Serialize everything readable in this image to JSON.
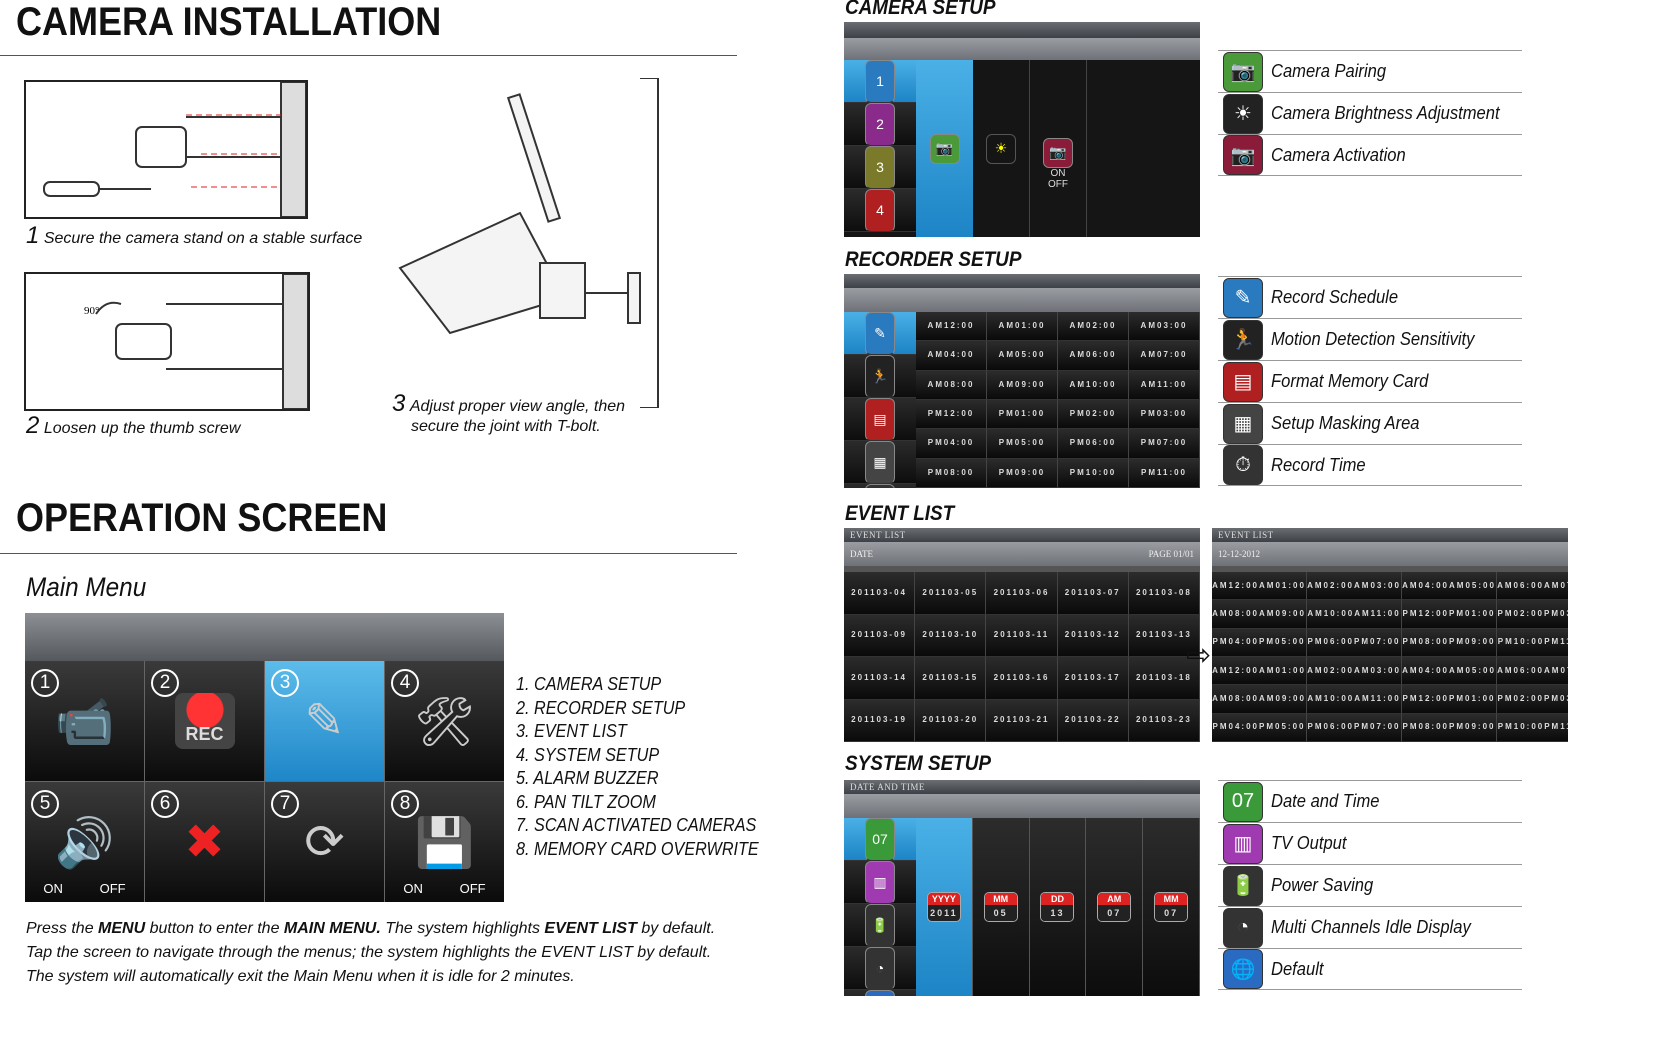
{
  "install": {
    "title": "CAMERA INSTALLATION",
    "step1_num": "1",
    "step1": "Secure  the camera stand on a stable surface",
    "step2_num": "2",
    "step2": "Loosen up the thumb screw",
    "angle": "90°",
    "step3_num": "3",
    "step3_a": "Adjust proper view angle, then",
    "step3_b": "secure the joint with T-bolt."
  },
  "operation": {
    "title": "OPERATION SCREEN",
    "subtitle": "Main Menu",
    "tiles": [
      {
        "n": "1",
        "icon": "camera-tools-icon",
        "g": "📹"
      },
      {
        "n": "2",
        "icon": "rec-icon",
        "g": "REC"
      },
      {
        "n": "3",
        "icon": "event-list-icon",
        "g": "✎"
      },
      {
        "n": "4",
        "icon": "tools-icon",
        "g": "🛠"
      },
      {
        "n": "5",
        "icon": "speaker-icon",
        "g": "🔊"
      },
      {
        "n": "6",
        "icon": "ptz-disabled-icon",
        "g": "✖"
      },
      {
        "n": "7",
        "icon": "scan-cameras-icon",
        "g": "⟳"
      },
      {
        "n": "8",
        "icon": "memory-card-icon",
        "g": "💾"
      }
    ],
    "on": "ON",
    "off": "OFF",
    "items": [
      "1. CAMERA SETUP",
      "2. RECORDER SETUP",
      "3. EVENT LIST",
      "4. SYSTEM SETUP",
      "5. ALARM BUZZER",
      "6. PAN TILT ZOOM",
      "7. SCAN ACTIVATED CAMERAS",
      "8. MEMORY CARD OVERWRITE"
    ],
    "note1_a": "Press the ",
    "note1_b": "MENU",
    "note1_c": " button to enter the ",
    "note1_d": "MAIN MENU.",
    "note1_e": "  The system highlights ",
    "note1_f": "EVENT LIST",
    "note1_g": " by default.",
    "note2": "Tap the screen to navigate through the menus; the system highlights the EVENT LIST by default.",
    "note3": "The system will automatically exit the Main Menu when it is idle for 2 minutes."
  },
  "camera_setup": {
    "title": "CAMERA SETUP",
    "cams": [
      "1",
      "2",
      "3",
      "4"
    ],
    "on": "ON",
    "off": "OFF",
    "items": [
      {
        "label": "Camera Pairing",
        "icon": "camera-pairing-icon",
        "g": "📷",
        "c": "#4a9a3a"
      },
      {
        "label": "Camera Brightness Adjustment",
        "icon": "brightness-icon",
        "g": "☀",
        "c": "#222"
      },
      {
        "label": "Camera Activation",
        "icon": "camera-activation-icon",
        "g": "📷",
        "c": "#8a1c3a"
      }
    ]
  },
  "recorder_setup": {
    "title": "RECORDER SETUP",
    "times": [
      "AM12:00",
      "AM01:00",
      "AM02:00",
      "AM03:00",
      "AM04:00",
      "AM05:00",
      "AM06:00",
      "AM07:00",
      "AM08:00",
      "AM09:00",
      "AM10:00",
      "AM11:00",
      "PM12:00",
      "PM01:00",
      "PM02:00",
      "PM03:00",
      "PM04:00",
      "PM05:00",
      "PM06:00",
      "PM07:00",
      "PM08:00",
      "PM09:00",
      "PM10:00",
      "PM11:00"
    ],
    "items": [
      {
        "label": "Record Schedule",
        "icon": "record-schedule-icon",
        "g": "✎",
        "c": "#2a7ac0"
      },
      {
        "label": "Motion Detection Sensitivity",
        "icon": "motion-icon",
        "g": "🏃",
        "c": "#222"
      },
      {
        "label": "Format Memory Card",
        "icon": "format-card-icon",
        "g": "▤",
        "c": "#b02020"
      },
      {
        "label": "Setup Masking Area",
        "icon": "masking-icon",
        "g": "▦",
        "c": "#444"
      },
      {
        "label": "Record Time",
        "icon": "stopwatch-icon",
        "g": "⏱",
        "c": "#333"
      }
    ]
  },
  "event_list": {
    "title": "EVENT LIST",
    "bar": "EVENT LIST",
    "date_label": "DATE",
    "page": "PAGE    01/01",
    "date": "12-12-2012",
    "dates": [
      "03-04",
      "03-05",
      "03-06",
      "03-07",
      "03-08",
      "03-09",
      "03-10",
      "03-11",
      "03-12",
      "03-13",
      "03-14",
      "03-15",
      "03-16",
      "03-17",
      "03-18",
      "03-19",
      "03-20",
      "03-21",
      "03-22",
      "03-23"
    ],
    "year": "2011",
    "slots": [
      [
        "AM12:00",
        "AM01:00"
      ],
      [
        "AM02:00",
        "AM03:00"
      ],
      [
        "AM04:00",
        "AM05:00"
      ],
      [
        "AM06:00",
        "AM07:00"
      ],
      [
        "AM08:00",
        "AM09:00"
      ],
      [
        "AM10:00",
        "AM11:00"
      ],
      [
        "PM12:00",
        "PM01:00"
      ],
      [
        "PM02:00",
        "PM03:00"
      ],
      [
        "PM04:00",
        "PM05:00"
      ],
      [
        "PM06:00",
        "PM07:00"
      ],
      [
        "PM08:00",
        "PM09:00"
      ],
      [
        "PM10:00",
        "PM11:00"
      ],
      [
        "AM12:00",
        "AM01:00"
      ],
      [
        "AM02:00",
        "AM03:00"
      ],
      [
        "AM04:00",
        "AM05:00"
      ],
      [
        "AM06:00",
        "AM07:00"
      ],
      [
        "AM08:00",
        "AM09:00"
      ],
      [
        "AM10:00",
        "AM11:00"
      ],
      [
        "PM12:00",
        "PM01:00"
      ],
      [
        "PM02:00",
        "PM03:00"
      ],
      [
        "PM04:00",
        "PM05:00"
      ],
      [
        "PM06:00",
        "PM07:00"
      ],
      [
        "PM08:00",
        "PM09:00"
      ],
      [
        "PM10:00",
        "PM11:00"
      ]
    ]
  },
  "system_setup": {
    "title": "SYSTEM SETUP",
    "bar": "DATE AND TIME",
    "fields": [
      {
        "k": "YYYY",
        "v": "2011"
      },
      {
        "k": "MM",
        "v": "05"
      },
      {
        "k": "DD",
        "v": "13"
      },
      {
        "k": "AM",
        "v": "07"
      },
      {
        "k": "MM",
        "v": "07"
      }
    ],
    "items": [
      {
        "label": "Date and Time",
        "icon": "calendar-icon",
        "g": "07",
        "c": "#3a9a3a"
      },
      {
        "label": "TV Output",
        "icon": "tv-output-icon",
        "g": "▥",
        "c": "#a03ab0"
      },
      {
        "label": "Power Saving",
        "icon": "power-saving-icon",
        "g": "🔋",
        "c": "#333"
      },
      {
        "label": "Multi Channels Idle Display",
        "icon": "idle-display-icon",
        "g": "◔",
        "c": "#333"
      },
      {
        "label": "Default",
        "icon": "globe-icon",
        "g": "🌐",
        "c": "#2a6ac0"
      }
    ]
  },
  "colors": {
    "highlight": "#2a9ad8",
    "screen": "#151515"
  }
}
